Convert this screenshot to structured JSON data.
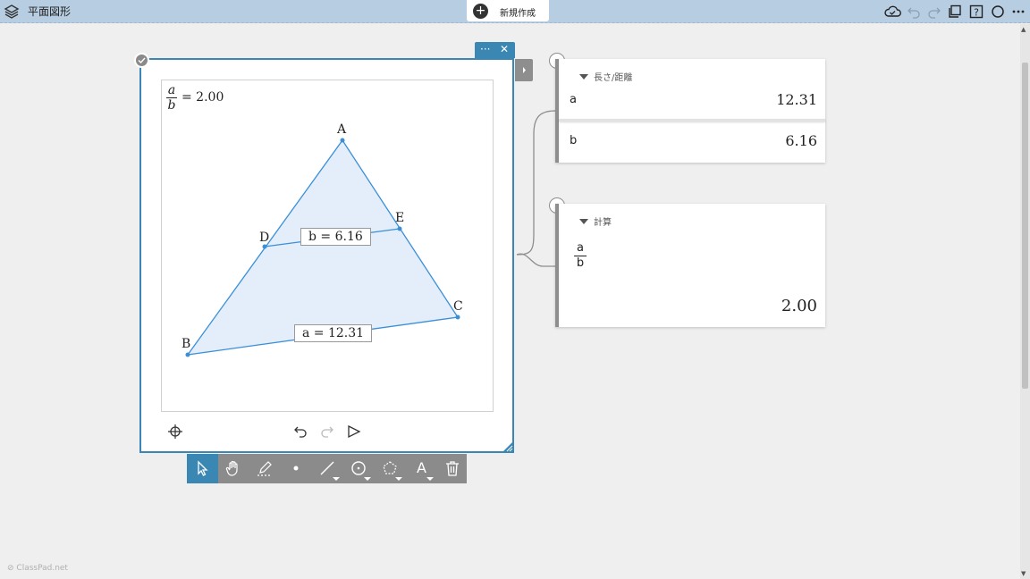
{
  "app": {
    "title": "平面図形",
    "new_label": "新規作成",
    "footer": "ClassPad.net"
  },
  "topbar_icons": [
    "layers-icon",
    "cloud-icon",
    "undo-icon",
    "redo-icon",
    "copy-icon",
    "help-icon",
    "circle-icon",
    "more-icon"
  ],
  "geometry": {
    "expr_num": "a",
    "expr_den": "b",
    "expr_value": "= 2.00",
    "points": {
      "A": "A",
      "B": "B",
      "C": "C",
      "D": "D",
      "E": "E"
    },
    "measure_b": "b = 6.16",
    "measure_a": "a = 12.31",
    "menu_more": "···",
    "menu_close": "✕"
  },
  "toolbar": {
    "tools": [
      "select",
      "pan",
      "pen",
      "point",
      "line",
      "circle",
      "polygon",
      "text",
      "delete"
    ],
    "text_tool_label": "A",
    "active": "select"
  },
  "length_card": {
    "header": "長さ/距離",
    "rows": [
      {
        "label": "a",
        "value": "12.31"
      },
      {
        "label": "b",
        "value": "6.16"
      }
    ]
  },
  "calc_card": {
    "header": "計算",
    "num": "a",
    "den": "b",
    "value": "2.00"
  },
  "colors": {
    "accent": "#3a87b3",
    "fill": "#e3eefa",
    "line": "#3a8fd8"
  }
}
